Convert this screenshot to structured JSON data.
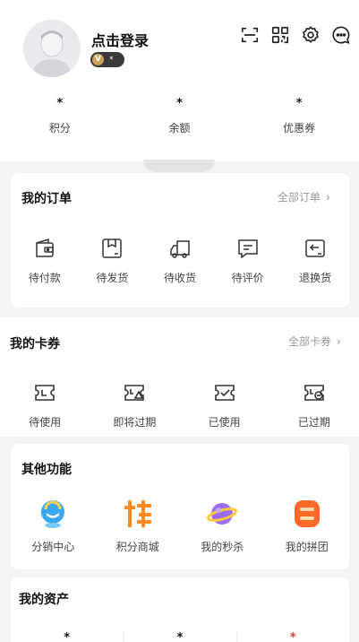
{
  "profile": {
    "login_title": "点击登录",
    "level_badge": "V",
    "level_value": "*"
  },
  "stats": [
    {
      "value": "*",
      "label": "积分"
    },
    {
      "value": "*",
      "label": "余额"
    },
    {
      "value": "*",
      "label": "优惠券"
    }
  ],
  "orders": {
    "title": "我的订单",
    "all_link": "全部订单",
    "items": [
      {
        "label": "待付款",
        "icon": "wallet-icon"
      },
      {
        "label": "待发货",
        "icon": "package-icon"
      },
      {
        "label": "待收货",
        "icon": "truck-icon"
      },
      {
        "label": "待评价",
        "icon": "comment-icon"
      },
      {
        "label": "退换货",
        "icon": "return-icon"
      }
    ]
  },
  "coupons": {
    "title": "我的卡券",
    "all_link": "全部卡券",
    "items": [
      {
        "label": "待使用",
        "icon": "ticket-unused-icon"
      },
      {
        "label": "即将过期",
        "icon": "ticket-warning-icon"
      },
      {
        "label": "已使用",
        "icon": "ticket-check-icon"
      },
      {
        "label": "已过期",
        "icon": "ticket-expired-icon"
      }
    ]
  },
  "other": {
    "title": "其他功能",
    "items": [
      {
        "label": "分销中心",
        "icon": "distribution-icon",
        "color": "#3aa7f5"
      },
      {
        "label": "积分商城",
        "icon": "group-buy-pin-icon",
        "color": "#ff8a1e"
      },
      {
        "label": "我的秒杀",
        "icon": "planet-icon",
        "color": "#9b6cf2"
      },
      {
        "label": "我的拼团",
        "icon": "group-buy-icon",
        "color": "#ff6a2a"
      }
    ]
  },
  "assets": {
    "title": "我的资产",
    "values": [
      "*",
      "*",
      "*"
    ]
  },
  "colors": {
    "accent_red": "#e53935",
    "badge_gold": "#c9a45a"
  }
}
